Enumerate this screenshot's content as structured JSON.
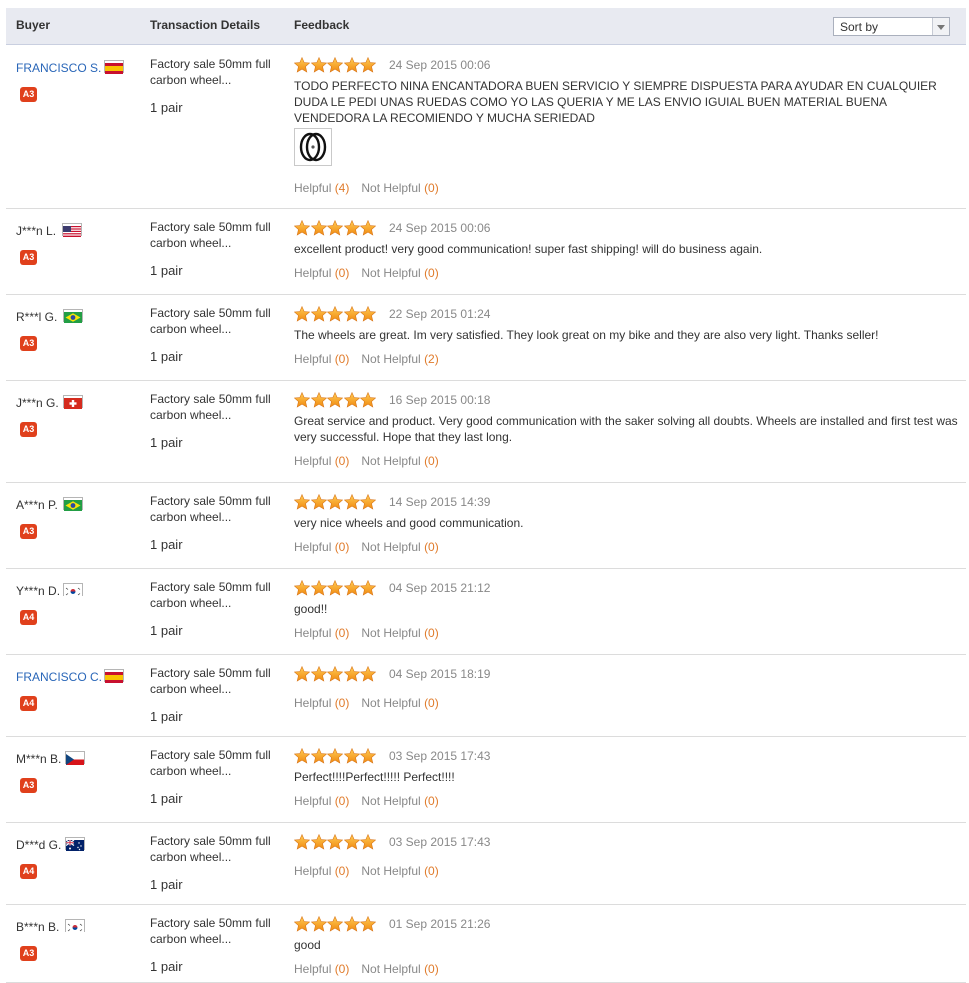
{
  "header": {
    "buyer": "Buyer",
    "transaction": "Transaction Details",
    "feedback": "Feedback",
    "sort_label": "Sort by"
  },
  "colors": {
    "link": "#2966b8",
    "badge": "#e0401c",
    "star": "#f49a1a",
    "count": "#e07b2b"
  },
  "reviews": [
    {
      "buyer": "FRANCISCO S.",
      "link": true,
      "flag": "flag-es",
      "badge": "A3",
      "product": "Factory sale 50mm full carbon wheel...",
      "qty": "1 pair",
      "rating": 5,
      "date": "24 Sep 2015 00:06",
      "text": "TODO PERFECTO NINA ENCANTADORA BUEN SERVICIO Y SIEMPRE DISPUESTA PARA AYUDAR EN CUALQUIER DUDA LE PEDI UNAS RUEDAS COMO YO LAS QUERIA Y ME LAS ENVIO IGUIAL BUEN MATERIAL BUENA VENDEDORA LA RECOMIENDO Y MUCHA SERIEDAD",
      "image": "wheel-photo",
      "helpful_label": "Helpful",
      "helpful": "4",
      "nothelpful_label": "Not Helpful",
      "nothelpful": "0"
    },
    {
      "buyer": "J***n L.",
      "link": false,
      "flag": "flag-us",
      "badge": "A3",
      "product": "Factory sale 50mm full carbon wheel...",
      "qty": "1 pair",
      "rating": 5,
      "date": "24 Sep 2015 00:06",
      "text": "excellent product! very good communication! super fast shipping! will do business again.",
      "helpful_label": "Helpful",
      "helpful": "0",
      "nothelpful_label": "Not Helpful",
      "nothelpful": "0"
    },
    {
      "buyer": "R***l G.",
      "link": false,
      "flag": "flag-br",
      "badge": "A3",
      "product": "Factory sale 50mm full carbon wheel...",
      "qty": "1 pair",
      "rating": 5,
      "date": "22 Sep 2015 01:24",
      "text": "The wheels are great. Im very satisfied. They look great on my bike and they are also very light. Thanks seller!",
      "helpful_label": "Helpful",
      "helpful": "0",
      "nothelpful_label": "Not Helpful",
      "nothelpful": "2"
    },
    {
      "buyer": "J***n G.",
      "link": false,
      "flag": "flag-ch",
      "badge": "A3",
      "product": "Factory sale 50mm full carbon wheel...",
      "qty": "1 pair",
      "rating": 5,
      "date": "16 Sep 2015 00:18",
      "text": "Great service and product. Very good communication with the saker solving all doubts. Wheels are installed and first test was very successful. Hope that they last long.",
      "helpful_label": "Helpful",
      "helpful": "0",
      "nothelpful_label": "Not Helpful",
      "nothelpful": "0"
    },
    {
      "buyer": "A***n P.",
      "link": false,
      "flag": "flag-br",
      "badge": "A3",
      "product": "Factory sale 50mm full carbon wheel...",
      "qty": "1 pair",
      "rating": 5,
      "date": "14 Sep 2015 14:39",
      "text": "very nice wheels and good communication.",
      "helpful_label": "Helpful",
      "helpful": "0",
      "nothelpful_label": "Not Helpful",
      "nothelpful": "0"
    },
    {
      "buyer": "Y***n D.",
      "link": false,
      "flag": "flag-kr",
      "badge": "A4",
      "product": "Factory sale 50mm full carbon wheel...",
      "qty": "1 pair",
      "rating": 5,
      "date": "04 Sep 2015 21:12",
      "text": "good!!",
      "helpful_label": "Helpful",
      "helpful": "0",
      "nothelpful_label": "Not Helpful",
      "nothelpful": "0"
    },
    {
      "buyer": "FRANCISCO C.",
      "link": true,
      "flag": "flag-es",
      "badge": "A4",
      "product": "Factory sale 50mm full carbon wheel...",
      "qty": "1 pair",
      "rating": 5,
      "date": "04 Sep 2015 18:19",
      "text": "",
      "helpful_label": "Helpful",
      "helpful": "0",
      "nothelpful_label": "Not Helpful",
      "nothelpful": "0"
    },
    {
      "buyer": "M***n B.",
      "link": false,
      "flag": "flag-cz",
      "badge": "A3",
      "product": "Factory sale 50mm full carbon wheel...",
      "qty": "1 pair",
      "rating": 5,
      "date": "03 Sep 2015 17:43",
      "text": "Perfect!!!!Perfect!!!!! Perfect!!!!",
      "helpful_label": "Helpful",
      "helpful": "0",
      "nothelpful_label": "Not Helpful",
      "nothelpful": "0"
    },
    {
      "buyer": "D***d G.",
      "link": false,
      "flag": "flag-au",
      "badge": "A4",
      "product": "Factory sale 50mm full carbon wheel...",
      "qty": "1 pair",
      "rating": 5,
      "date": "03 Sep 2015 17:43",
      "text": "",
      "helpful_label": "Helpful",
      "helpful": "0",
      "nothelpful_label": "Not Helpful",
      "nothelpful": "0"
    },
    {
      "buyer": "B***n B.",
      "link": false,
      "flag": "flag-kr",
      "badge": "A3",
      "product": "Factory sale 50mm full carbon wheel...",
      "qty": "1 pair",
      "rating": 5,
      "date": "01 Sep 2015 21:26",
      "text": "good",
      "helpful_label": "Helpful",
      "helpful": "0",
      "nothelpful_label": "Not Helpful",
      "nothelpful": "0"
    }
  ]
}
